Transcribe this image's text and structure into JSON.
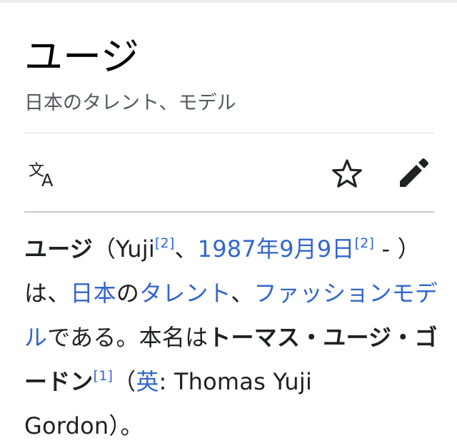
{
  "page": {
    "title": "ユージ",
    "description": "日本のタレント、モデル"
  },
  "toolbar": {
    "icons": [
      "language-icon",
      "star-icon",
      "edit-pencil-icon"
    ]
  },
  "lead": {
    "subject": "ユージ",
    "paren_open": "（",
    "latin_name": "Yuji",
    "ref_a": "[2]",
    "sep1": "、",
    "birth_date": "1987年9月9日",
    "ref_b": "[2]",
    "dash_part": " - ）は、",
    "link_japan": "日本",
    "no": "の",
    "link_talent": "タレント",
    "sep2": "、",
    "link_fashion_model": "ファッションモデル",
    "text_de_aru": "である。本名は",
    "real_name": "トーマス・ユージ・ゴードン",
    "ref_c": "[1]",
    "paren_open2": "（",
    "link_english": "英",
    "english_name": ": Thomas Yuji Gordon）。"
  },
  "colors": {
    "link": "#3366cc",
    "text": "#202122",
    "muted": "#54595d",
    "divider": "#c8ccd1"
  }
}
